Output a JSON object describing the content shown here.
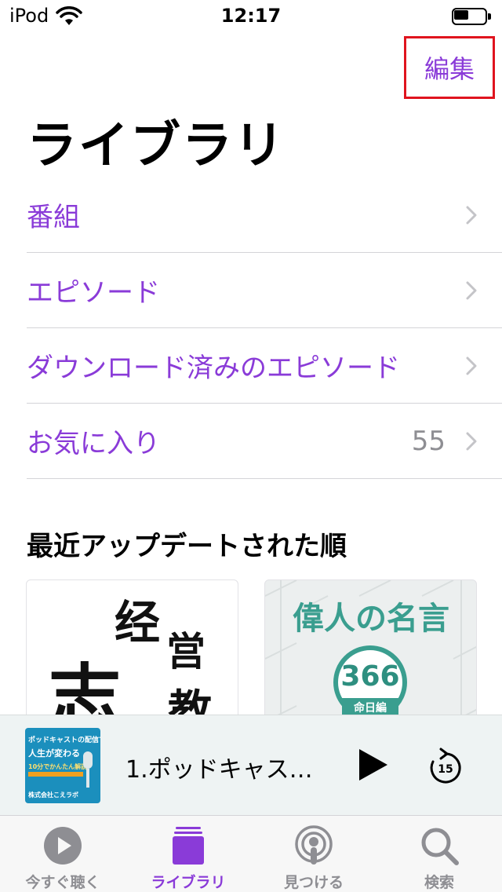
{
  "status_bar": {
    "carrier": "iPod",
    "time": "12:17",
    "battery_level": 0.45
  },
  "header": {
    "edit_label": "編集",
    "title": "ライブラリ"
  },
  "library_items": [
    {
      "label": "番組",
      "count": ""
    },
    {
      "label": "エピソード",
      "count": ""
    },
    {
      "label": "ダウンロード済みのエピソード",
      "count": ""
    },
    {
      "label": "お気に入り",
      "count": "55"
    }
  ],
  "recent_section": {
    "title": "最近アップデートされた順",
    "tiles": [
      {
        "title_chars": [
          "经",
          "営",
          "志",
          "教"
        ]
      },
      {
        "title": "偉人の名言",
        "badge_number": "366",
        "badge_subtitle": "命日編"
      }
    ]
  },
  "mini_player": {
    "artwork_lines": [
      "ポッドキャストの配信で",
      "人生が変わる",
      "10分でかんたん解説",
      "株式会社こえラボ"
    ],
    "episode_title": "1.ポッドキャス…",
    "skip_seconds": "15"
  },
  "tab_bar": {
    "tabs": [
      {
        "label": "今すぐ聴く",
        "icon": "play-circle-icon",
        "active": false
      },
      {
        "label": "ライブラリ",
        "icon": "library-stack-icon",
        "active": true
      },
      {
        "label": "見つける",
        "icon": "podcast-antenna-icon",
        "active": false
      },
      {
        "label": "検索",
        "icon": "magnifier-icon",
        "active": false
      }
    ]
  },
  "colors": {
    "accent": "#8a3bd8",
    "highlight_box": "#e0141e",
    "secondary_text": "#8e8e93",
    "mini_player_bg": "#eef3f3"
  }
}
